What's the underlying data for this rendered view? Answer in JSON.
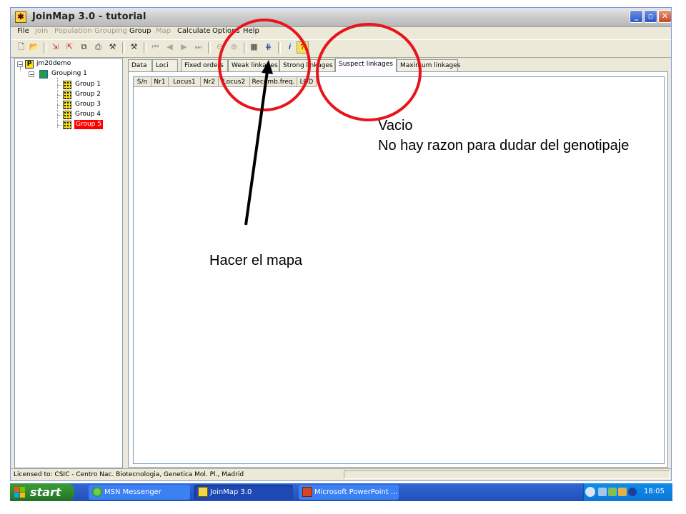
{
  "window": {
    "title": "JoinMap 3.0  -  tutorial",
    "buttons": {
      "minimize": "_",
      "maximize": "▫",
      "close": "✕"
    }
  },
  "menu": [
    {
      "label": "File",
      "enabled": true
    },
    {
      "label": "Join",
      "enabled": false
    },
    {
      "label": "Population",
      "enabled": false
    },
    {
      "label": "Grouping",
      "enabled": false
    },
    {
      "label": "Group",
      "enabled": true
    },
    {
      "label": "Map",
      "enabled": false
    },
    {
      "label": "Calculate",
      "enabled": true
    },
    {
      "label": "Options",
      "enabled": true
    },
    {
      "label": "Help",
      "enabled": true
    }
  ],
  "tree": {
    "project": "jm20demo",
    "grouping": "Grouping 1",
    "groups": [
      "Group 1",
      "Group 2",
      "Group 3",
      "Group 4",
      "Group 5"
    ],
    "selected_index": 4,
    "selected_color": "#ff0000"
  },
  "tabs": [
    "Data",
    "Loci",
    "Fixed orders",
    "Weak linkages",
    "Strong linkages",
    "Suspect linkages",
    "Maximum linkages"
  ],
  "active_tab": "Suspect linkages",
  "columns": [
    "S/n",
    "Nr1",
    "Locus1",
    "Nr2",
    "Locus2",
    "Recomb.freq.",
    "LOD"
  ],
  "status": {
    "license": "Licensed to: CSIC - Centro Nac. Biotecnologia, Genetica Mol. Pl., Madrid"
  },
  "taskbar": {
    "start": "start",
    "tasks": [
      {
        "label": "MSN Messenger",
        "active": false
      },
      {
        "label": "JoinMap 3.0",
        "active": true
      },
      {
        "label": "Microsoft PowerPoint ...",
        "active": false
      }
    ],
    "clock": "18:05"
  },
  "annotations": {
    "vacio": "Vacio",
    "no_hay": "No hay razon para dudar del genotipaje",
    "hacer": "Hacer el mapa",
    "circle_color": "#e8141c",
    "arrow_color": "#000000"
  }
}
